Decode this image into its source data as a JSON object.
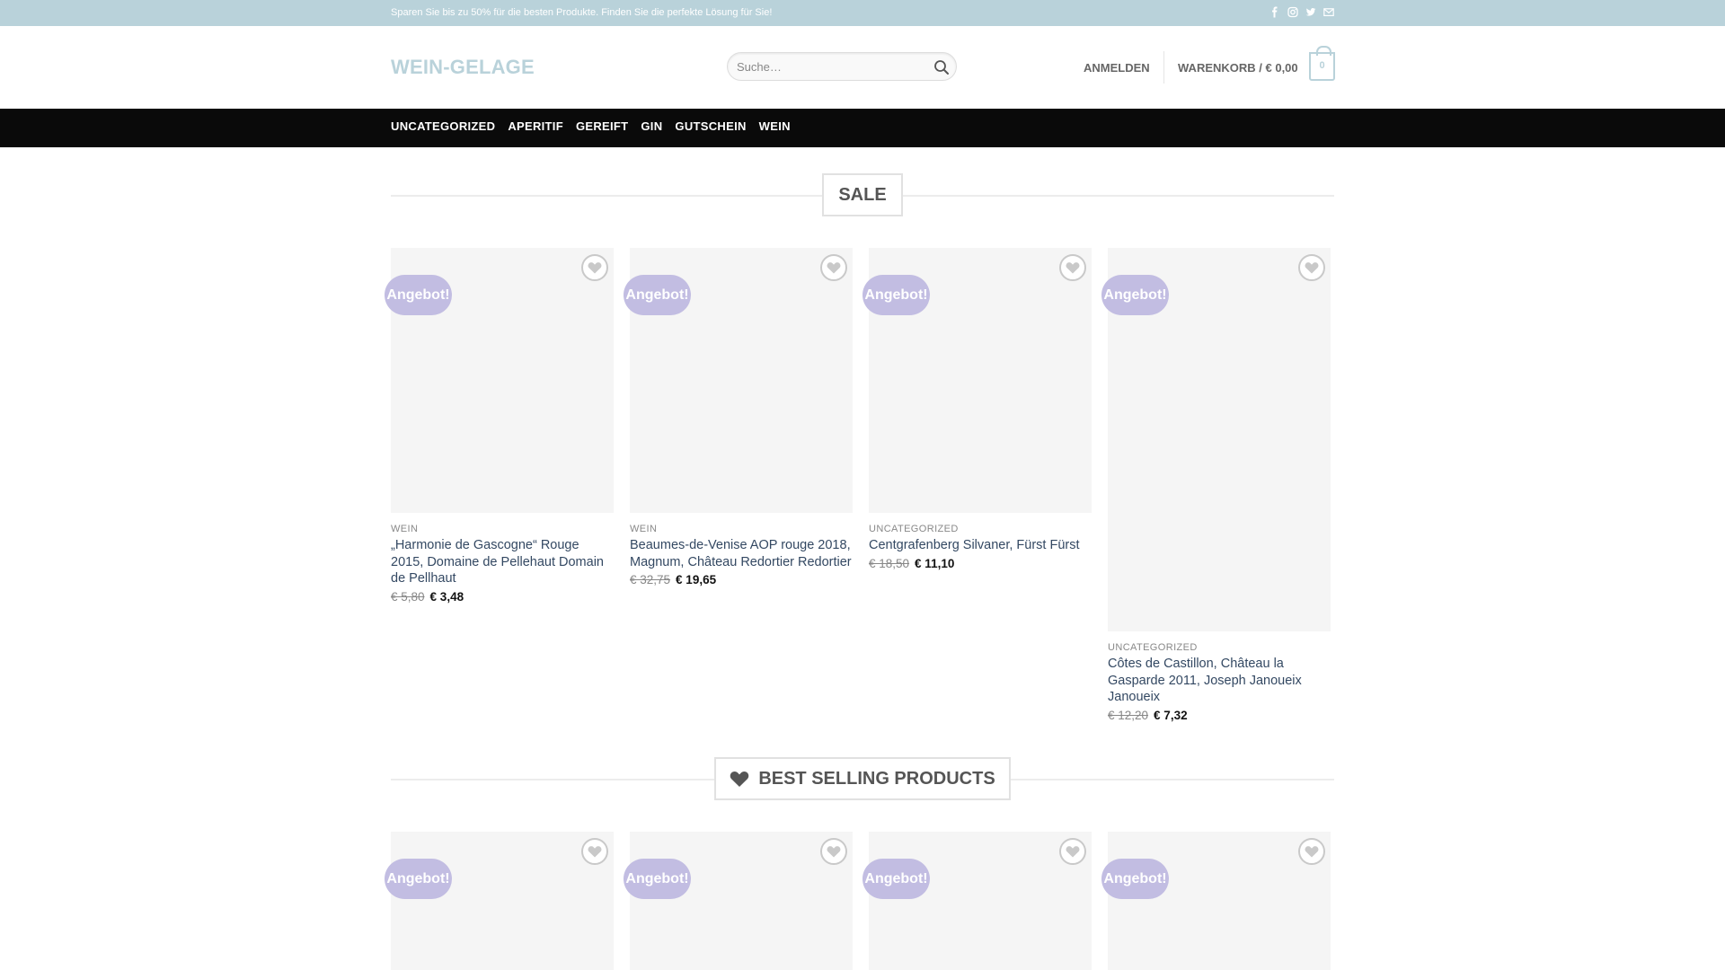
{
  "topbar": {
    "message": "Sparen Sie bis zu 50% für die besten Produkte. Finden Sie die perfekte Lösung für Sie!",
    "social_icons": [
      "facebook-icon",
      "instagram-icon",
      "twitter-icon",
      "envelope-icon"
    ]
  },
  "header": {
    "logo": "WEIN-GELAGE",
    "search_placeholder": "Suche…",
    "login_label": "ANMELDEN",
    "cart_label": "WARENKORB / € 0,00",
    "cart_count": "0"
  },
  "nav": {
    "items": [
      "UNCATEGORIZED",
      "APERITIF",
      "GEREIFT",
      "GIN",
      "GUTSCHEIN",
      "WEIN"
    ]
  },
  "sale": {
    "title": "SALE",
    "products": [
      {
        "badge": "Angebot!",
        "category": "WEIN",
        "name": "„Harmonie de Gascogne“ Rouge 2015, Domaine de Pellehaut Domain de Pellhaut",
        "old_price": "€ 5,80",
        "price": "€ 3,48"
      },
      {
        "badge": "Angebot!",
        "category": "WEIN",
        "name": "Beaumes-de-Venise AOP rouge 2018, Magnum, Château Redortier Redortier",
        "old_price": "€ 32,75",
        "price": "€ 19,65"
      },
      {
        "badge": "Angebot!",
        "category": "UNCATEGORIZED",
        "name": "Centgrafenberg Silvaner, Fürst Fürst",
        "old_price": "€ 18,50",
        "price": "€ 11,10"
      },
      {
        "badge": "Angebot!",
        "category": "UNCATEGORIZED",
        "name": "Côtes de Castillon, Château la Gasparde 2011, Joseph Janoueix Janoueix",
        "old_price": "€ 12,20",
        "price": "€ 7,32"
      }
    ]
  },
  "best_selling": {
    "title": "BEST SELLING PRODUCTS",
    "products": [
      {
        "badge": "Angebot!"
      },
      {
        "badge": "Angebot!"
      },
      {
        "badge": "Angebot!"
      },
      {
        "badge": "Angebot!"
      }
    ]
  },
  "colors": {
    "accent": "#b9d2da",
    "badge": "#c2bde2",
    "nav_bg": "#0a0a0a",
    "link": "#334862"
  }
}
